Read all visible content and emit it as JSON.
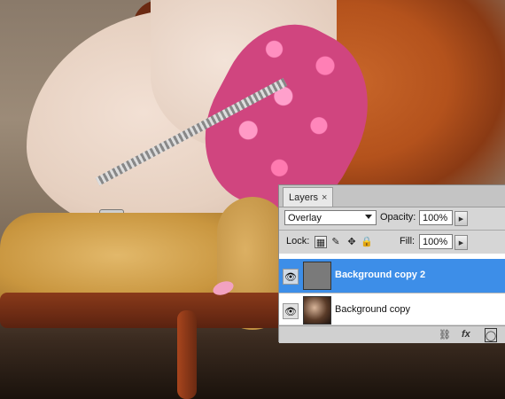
{
  "panel": {
    "tab_label": "Layers",
    "tab_close": "×",
    "blend_mode": "Overlay",
    "opacity_label": "Opacity:",
    "opacity_value": "100%",
    "lock_label": "Lock:",
    "fill_label": "Fill:",
    "fill_value": "100%"
  },
  "layers": [
    {
      "name": "Background copy 2",
      "selected": true,
      "thumb": "gray"
    },
    {
      "name": "Background copy",
      "selected": false,
      "thumb": "photo"
    }
  ],
  "footer": {
    "icons": [
      "link-icon",
      "fx-icon",
      "mask-icon"
    ],
    "fx_text": "fx"
  },
  "colors": {
    "selection": "#3d8ee8",
    "panel_bg": "#d6d6d6"
  }
}
